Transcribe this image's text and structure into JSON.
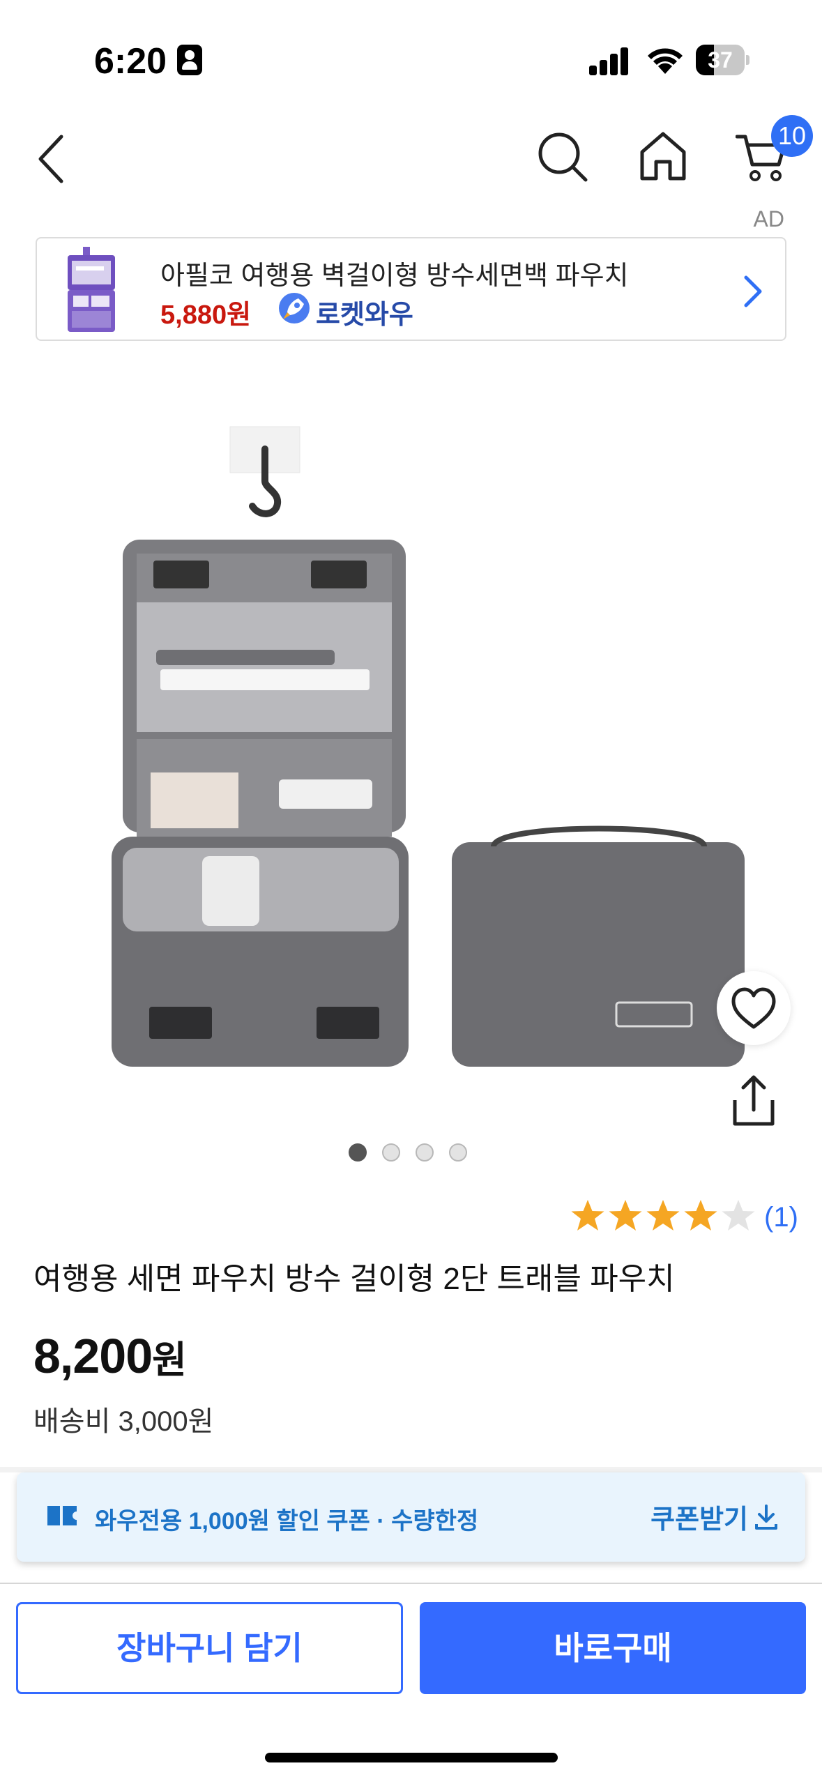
{
  "status_bar": {
    "time": "6:20",
    "battery": "37",
    "battery_level": 0.37
  },
  "nav": {
    "cart_badge": "10"
  },
  "ad": {
    "label": "AD",
    "title": "아필코 여행용 벽걸이형 방수세면백 파우치",
    "price": "5,880원",
    "rocket_label": "로켓와우"
  },
  "gallery": {
    "total_images": 4,
    "active_index": 0
  },
  "rating": {
    "stars": 4,
    "max_stars": 5,
    "count": "(1)"
  },
  "product": {
    "title": "여행용 세면 파우치 방수 걸이형 2단 트래블 파우치",
    "price_number": "8,200",
    "price_unit": "원",
    "shipping": "배송비 3,000원"
  },
  "coupon": {
    "text": "와우전용 1,000원 할인 쿠폰 · 수량한정",
    "button_label": "쿠폰받기"
  },
  "actions": {
    "cart_label": "장바구니 담기",
    "buy_label": "바로구매"
  },
  "colors": {
    "accent": "#346aff",
    "badge": "#2f6ff5",
    "ad_price": "#c9180e",
    "rocket": "#264aa8",
    "coupon_text": "#1c73c7",
    "coupon_bg": "#e9f4fd",
    "star_filled": "#f5a623",
    "star_empty": "#e3e3e3"
  }
}
